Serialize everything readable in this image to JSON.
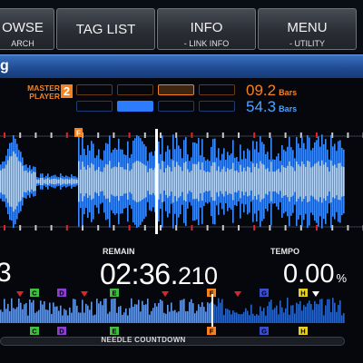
{
  "tabs": [
    {
      "label": "OWSE",
      "sub": "ARCH"
    },
    {
      "label": "TAG LIST",
      "sub": ""
    },
    {
      "label": "INFO",
      "sub": "- LINK INFO"
    },
    {
      "label": "MENU",
      "sub": "- UTILITY"
    }
  ],
  "track_title": "g",
  "master": {
    "label_line1": "MASTER",
    "label_line2": "PLAYER",
    "player_number": "2",
    "bars_master": "09.2",
    "bars_local": "54.3",
    "bars_unit": "Bars",
    "beat_active_master": 3,
    "beat_active_local": 2,
    "colors": {
      "master": "#f58220",
      "local": "#2d7cff"
    }
  },
  "waveform": {
    "cue_marker_letter": "F",
    "colors": {
      "cue": "#f58220",
      "wave_core": "#cfe6ff",
      "wave_outer": "#3b8bff",
      "tick": "#e0242b"
    }
  },
  "time": {
    "left_digit": "3",
    "remain_label": "REMAIN",
    "remain_main": "02:36.",
    "remain_ms": "210",
    "tempo_label": "TEMPO",
    "tempo_value": "0.00",
    "tempo_unit": "%"
  },
  "overview": {
    "hot_cues": [
      {
        "letter": "C",
        "color": "#3fbf3f"
      },
      {
        "letter": "D",
        "color": "#8a3fd0"
      },
      {
        "letter": "E",
        "color": "#3fbf3f"
      },
      {
        "letter": "F",
        "color": "#f58220"
      },
      {
        "letter": "G",
        "color": "#3a4fd0"
      },
      {
        "letter": "H",
        "color": "#e8d020"
      }
    ],
    "needle_label": "NEEDLE COUNTDOWN"
  }
}
